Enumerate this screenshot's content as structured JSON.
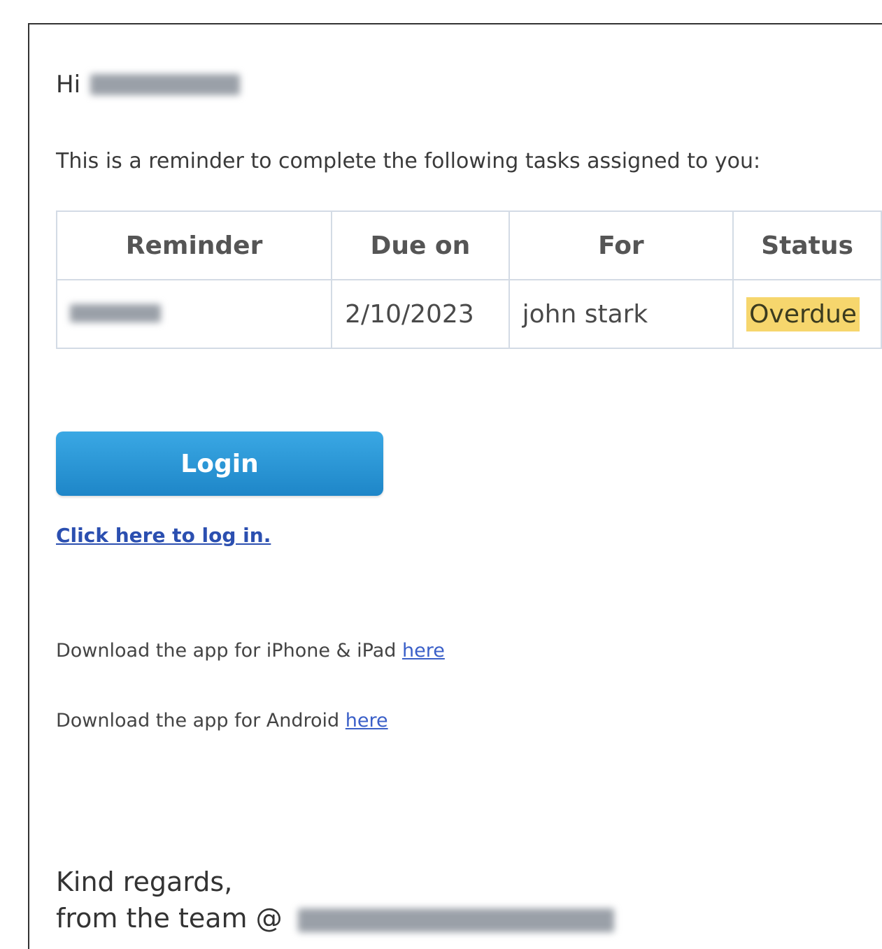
{
  "greeting": {
    "prefix": "Hi"
  },
  "intro_text": "This is a reminder to complete the following tasks assigned to you:",
  "table": {
    "headers": [
      "Reminder",
      "Due on",
      "For",
      "Status"
    ],
    "rows": [
      {
        "due_on": "2/10/2023",
        "for": "john stark",
        "status": "Overdue"
      }
    ]
  },
  "login": {
    "button_label": "Login",
    "link_text": "Click here to log in."
  },
  "apps": {
    "iphone_text": "Download the app for iPhone & iPad",
    "iphone_link": "here",
    "android_text": "Download the app for Android",
    "android_link": "here"
  },
  "signoff": {
    "line1": "Kind regards,",
    "line2": "from the team @"
  },
  "colors": {
    "status_overdue": "#f6d66d",
    "login_button": "#2a98d8",
    "link": "#2b4fb0",
    "table_border": "#d3dbe5"
  }
}
